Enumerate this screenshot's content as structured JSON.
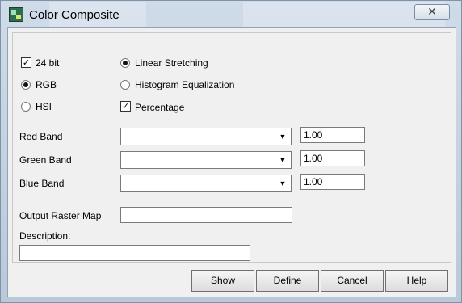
{
  "window": {
    "title": "Color Composite",
    "close_glyph": "✕"
  },
  "options": {
    "bit24": {
      "label": "24 bit",
      "checked": true
    },
    "rgb": {
      "label": "RGB",
      "selected": true
    },
    "hsi": {
      "label": "HSI",
      "selected": false
    },
    "linear": {
      "label": "Linear Stretching",
      "selected": true
    },
    "histogram": {
      "label": "Histogram Equalization",
      "selected": false
    },
    "percentage": {
      "label": "Percentage",
      "checked": true
    }
  },
  "bands": [
    {
      "label": "Red Band",
      "value": "",
      "percent": "1.00"
    },
    {
      "label": "Green Band",
      "value": "",
      "percent": "1.00"
    },
    {
      "label": "Blue Band",
      "value": "",
      "percent": "1.00"
    }
  ],
  "output": {
    "label": "Output Raster Map",
    "value": ""
  },
  "description": {
    "label": "Description:",
    "value": ""
  },
  "buttons": {
    "show": "Show",
    "define": "Define",
    "cancel": "Cancel",
    "help": "Help"
  },
  "icons": {
    "title": "app-map-icon",
    "close": "close-icon",
    "dropdown": "chevron-down-icon"
  }
}
